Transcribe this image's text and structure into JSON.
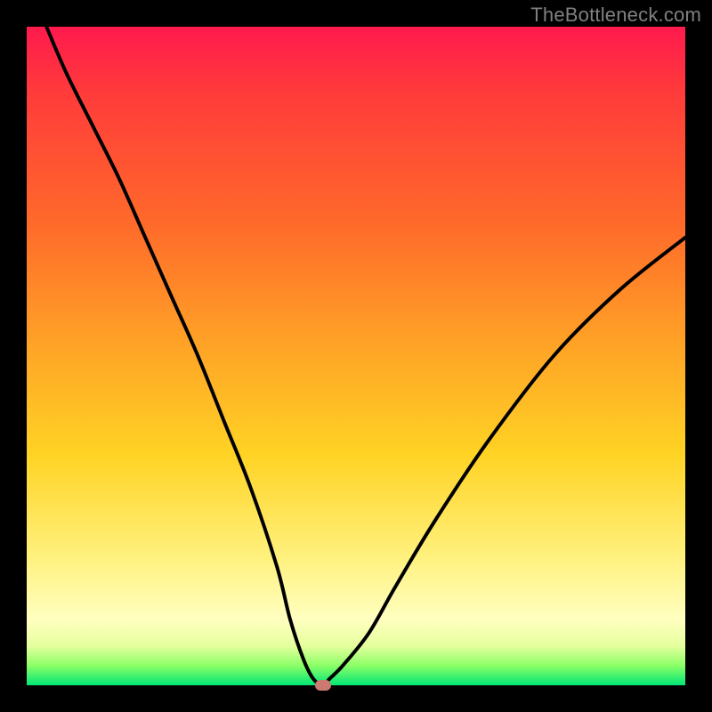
{
  "watermark": "TheBottleneck.com",
  "colors": {
    "frame_bg": "#000000",
    "curve_stroke": "#000000",
    "marker_fill": "#cc7a70",
    "watermark_text": "#808080"
  },
  "chart_data": {
    "type": "line",
    "title": "",
    "xlabel": "",
    "ylabel": "",
    "xlim": [
      0,
      100
    ],
    "ylim": [
      0,
      100
    ],
    "series": [
      {
        "name": "bottleneck-curve",
        "x": [
          3,
          6,
          10,
          14,
          18,
          22,
          26,
          30,
          34,
          38,
          40,
          42,
          43.5,
          45,
          46,
          48,
          52,
          56,
          62,
          70,
          80,
          90,
          100
        ],
        "y": [
          100,
          93,
          85,
          77,
          68,
          59,
          50,
          40,
          30,
          18,
          10,
          4,
          1,
          0,
          1,
          3,
          8,
          15,
          25,
          37,
          50,
          60,
          68
        ]
      }
    ],
    "annotations": [
      {
        "name": "min-marker",
        "x": 45,
        "y": 0
      }
    ],
    "grid": false,
    "legend": false
  }
}
